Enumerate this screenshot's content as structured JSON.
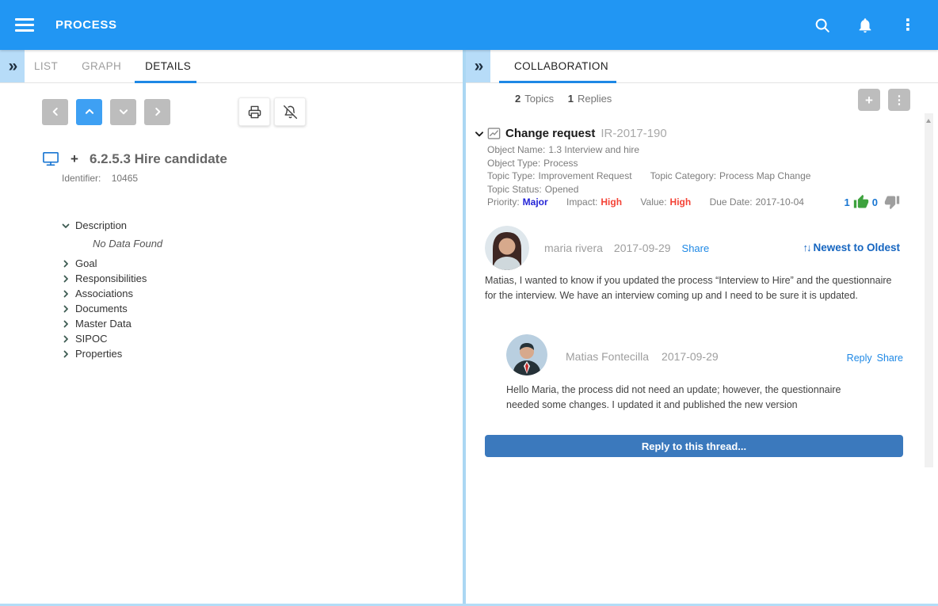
{
  "colors": {
    "appbar_blue": "#2196f3",
    "tab_underline": "#1e88e5",
    "active_nav_button": "#3ea0f3",
    "reply_button": "#3b79bd",
    "link_blue": "#1e88e5",
    "sort_blue": "#1565c0",
    "priority_major": "#2424d6",
    "impact_high_red": "#f44336",
    "like_green": "#3da23d",
    "dislike_gray": "#9e9e9e",
    "divider_light_blue": "#abd7f3"
  },
  "icons": {
    "double_chevron": "»",
    "kebab": "⋮",
    "plus": "+",
    "sort_arrows": "↑↓"
  },
  "app_bar": {
    "title": "PROCESS"
  },
  "left_panel": {
    "tabs": [
      {
        "label": "LIST"
      },
      {
        "label": "GRAPH"
      },
      {
        "label": "DETAILS"
      }
    ],
    "active_tab": "DETAILS",
    "object_header": {
      "title": "6.2.5.3 Hire candidate",
      "identifier_label": "Identifier:",
      "identifier_value": "10465"
    },
    "tree": {
      "description_label": "Description",
      "description_content": "No Data Found",
      "items": [
        {
          "label": "Goal"
        },
        {
          "label": "Responsibilities"
        },
        {
          "label": "Associations"
        },
        {
          "label": "Documents"
        },
        {
          "label": "Master Data"
        },
        {
          "label": "SIPOC"
        },
        {
          "label": "Properties"
        }
      ]
    }
  },
  "right_panel": {
    "tab": "COLLABORATION",
    "summary": {
      "topics_count": "2",
      "topics_label": "Topics",
      "replies_count": "1",
      "replies_label": "Replies"
    },
    "topic": {
      "title": "Change request",
      "reference": "IR-2017-190",
      "meta": [
        {
          "label": "Object Name:",
          "value": "1.3 Interview and hire"
        },
        {
          "label": "Object Type:",
          "value": "Process"
        },
        {
          "label": "Topic Type:",
          "value": "Improvement Request"
        },
        {
          "label": "Topic Category:",
          "value": "Process Map Change"
        },
        {
          "label": "Topic Status:",
          "value": "Opened"
        },
        {
          "label": "Priority:",
          "value": "Major"
        },
        {
          "label": "Impact:",
          "value": "High"
        },
        {
          "label": "Value:",
          "value": "High"
        },
        {
          "label": "Due Date:",
          "value": "2017-10-04"
        }
      ],
      "likes": "1",
      "dislikes": "0"
    },
    "sort": {
      "label": "Newest to Oldest"
    },
    "comments": [
      {
        "author": "maria rivera",
        "date": "2017-09-29",
        "share": "Share",
        "text": "Matias, I wanted to know if you updated the process “Interview to Hire” and the questionnaire for the interview. We have an interview coming up and I need to be sure it is updated."
      },
      {
        "author": "Matias Fontecilla",
        "date": "2017-09-29",
        "reply": "Reply",
        "share": "Share",
        "text": "Hello Maria, the process did not need an update; however, the questionnaire needed some changes. I updated it and published the new version"
      }
    ],
    "reply_button": "Reply to this thread..."
  }
}
